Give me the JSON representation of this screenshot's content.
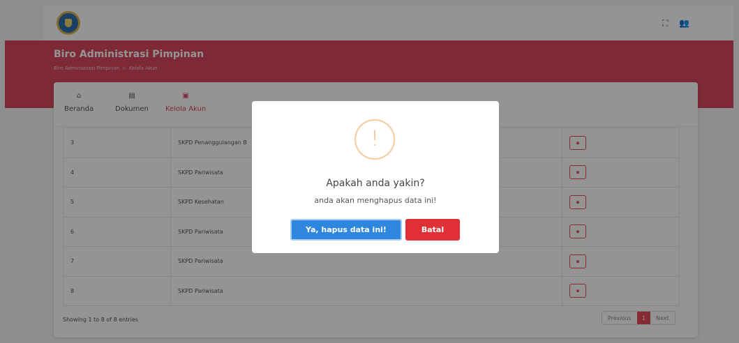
{
  "header": {
    "icons": [
      "fullscreen-icon",
      "user-icon"
    ],
    "fullscreen_glyph": "⛶",
    "user_glyph": "👥"
  },
  "hero": {
    "title": "Biro Administrasi Pimpinan",
    "breadcrumb": [
      "Biro Administrasi Pimpinan",
      ">",
      "Kelola Akun"
    ]
  },
  "tabs": [
    {
      "label": "Beranda",
      "icon": "home-icon",
      "glyph": "⌂"
    },
    {
      "label": "Dokumen",
      "icon": "document-icon",
      "glyph": "▤"
    },
    {
      "label": "Kelola Akun",
      "icon": "account-icon",
      "glyph": "▣"
    }
  ],
  "table": {
    "rows": [
      {
        "no": "3",
        "name": "SKPD Penanggulangan B"
      },
      {
        "no": "4",
        "name": "SKPD Pariwisata"
      },
      {
        "no": "5",
        "name": "SKPD Kesehatan"
      },
      {
        "no": "6",
        "name": "SKPD Pariwisata"
      },
      {
        "no": "7",
        "name": "SKPD Pariwisata"
      },
      {
        "no": "8",
        "name": "SKPD Pariwisata"
      }
    ]
  },
  "footer": {
    "info": "Showing 1 to 8 of 8 entries",
    "previous": "Previous",
    "page": "1",
    "next": "Next"
  },
  "modal": {
    "icon_glyph": "!",
    "title": "Apakah anda yakin?",
    "text": "anda akan menghapus data ini!",
    "confirm": "Ya, hapus data ini!",
    "cancel": "Batal"
  },
  "colors": {
    "brand": "#d7485f",
    "confirm": "#2f86de",
    "cancel": "#e02f35",
    "warning": "#f5b27a"
  }
}
